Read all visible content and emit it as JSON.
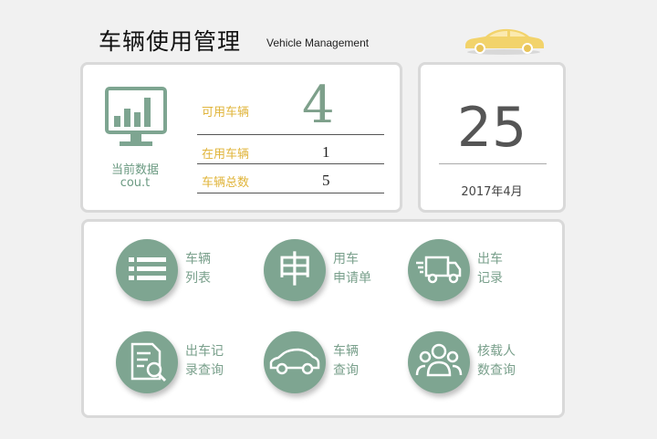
{
  "header": {
    "title": "车辆使用管理",
    "subtitle": "Vehicle Management",
    "logo_icon": "car-icon",
    "logo_color": "#f2d36b"
  },
  "stats": {
    "icon": "monitor-chart-icon",
    "current_label": "当前数据",
    "current_code": "cou.t",
    "available_label": "可用车辆",
    "available_value": "4",
    "in_use_label": "在用车辆",
    "in_use_value": "1",
    "total_label": "车辆总数",
    "total_value": "5"
  },
  "date": {
    "day": "25",
    "month": "2017年4月"
  },
  "menu": {
    "items": [
      {
        "icon": "list-icon",
        "line1": "车辆",
        "line2": "列表"
      },
      {
        "icon": "apply-icon",
        "glyph": "申",
        "line1": "用车",
        "line2": "申请单"
      },
      {
        "icon": "truck-icon",
        "line1": "出车",
        "line2": "记录"
      },
      {
        "icon": "document-search-icon",
        "line1": "出车记",
        "line2": "录查询"
      },
      {
        "icon": "car-icon",
        "line1": "车辆",
        "line2": "查询"
      },
      {
        "icon": "people-icon",
        "line1": "核载人",
        "line2": "数查询"
      }
    ]
  },
  "colors": {
    "accent_green": "#7ea591",
    "accent_yellow": "#e0b43a",
    "card_border": "#d9d9d9"
  }
}
